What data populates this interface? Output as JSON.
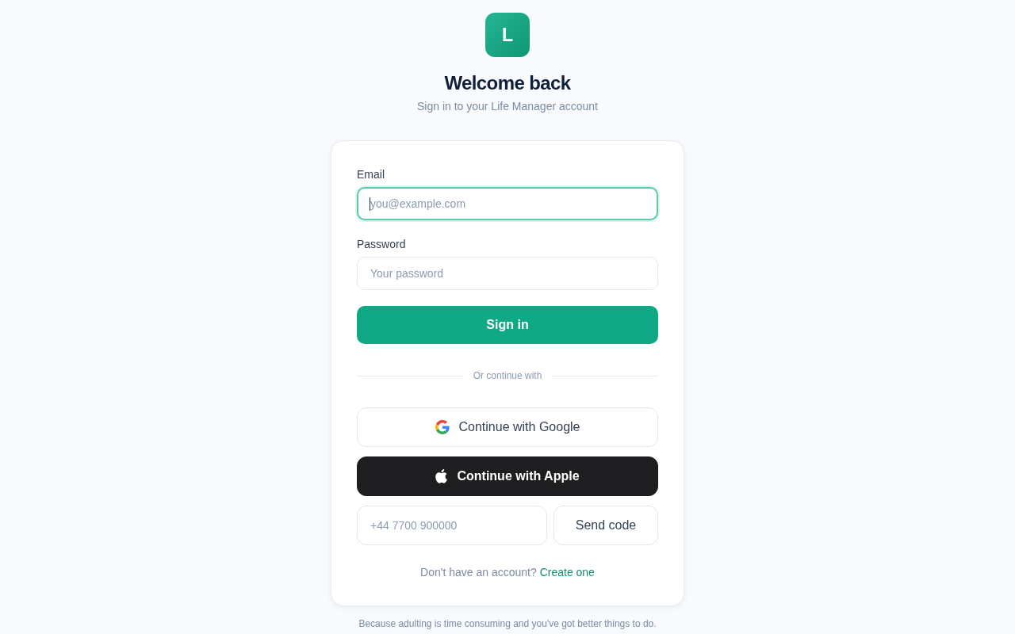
{
  "logo": {
    "letter": "L"
  },
  "title": "Welcome back",
  "subtitle": "Sign in to your Life Manager account",
  "form": {
    "fields": [
      {
        "label": "Email",
        "placeholder": "you@example.com",
        "focused": true
      },
      {
        "label": "Password",
        "placeholder": "Your password",
        "focused": false
      }
    ],
    "submit": "Sign in"
  },
  "divider": "Or continue with",
  "social_buttons": [
    {
      "kind": "google",
      "label": "Continue with Google"
    },
    {
      "kind": "apple",
      "label": "Continue with Apple"
    }
  ],
  "phone": {
    "placeholder": "+44 7700 900000",
    "button": "Send code"
  },
  "signup": {
    "prompt": "Don't have an account?",
    "link": "Create one"
  },
  "footer": "Because adulting is time consuming and you've got better things to do."
}
